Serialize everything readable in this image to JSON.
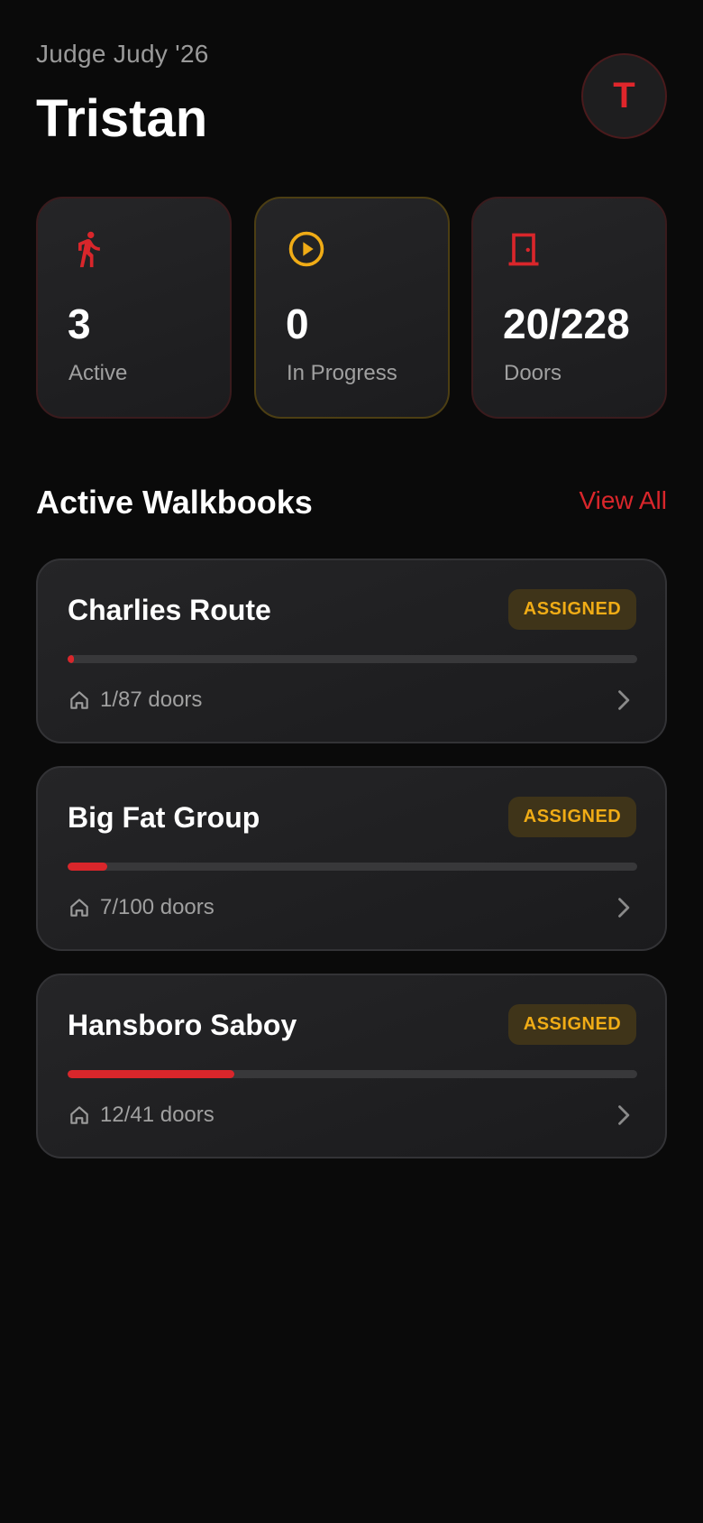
{
  "header": {
    "campaign": "Judge Judy '26",
    "user_name": "Tristan",
    "avatar_initial": "T"
  },
  "stats": [
    {
      "icon": "walking-person-icon",
      "value": "3",
      "label": "Active",
      "color": "#d9262b"
    },
    {
      "icon": "play-circle-icon",
      "value": "0",
      "label": "In Progress",
      "color": "#f0ac16"
    },
    {
      "icon": "door-icon",
      "value": "20/228",
      "label": "Doors",
      "color": "#d9262b"
    }
  ],
  "section": {
    "title": "Active Walkbooks",
    "view_all": "View All"
  },
  "walkbooks": [
    {
      "title": "Charlies Route",
      "badge": "ASSIGNED",
      "doors": "1/87 doors",
      "progress": 0.0115
    },
    {
      "title": "Big Fat Group",
      "badge": "ASSIGNED",
      "doors": "7/100 doors",
      "progress": 0.07
    },
    {
      "title": "Hansboro Saboy",
      "badge": "ASSIGNED",
      "doors": "12/41 doors",
      "progress": 0.2927
    }
  ],
  "colors": {
    "accent_red": "#d9262b",
    "accent_amber": "#f0ac16",
    "background": "#0a0a0a"
  }
}
